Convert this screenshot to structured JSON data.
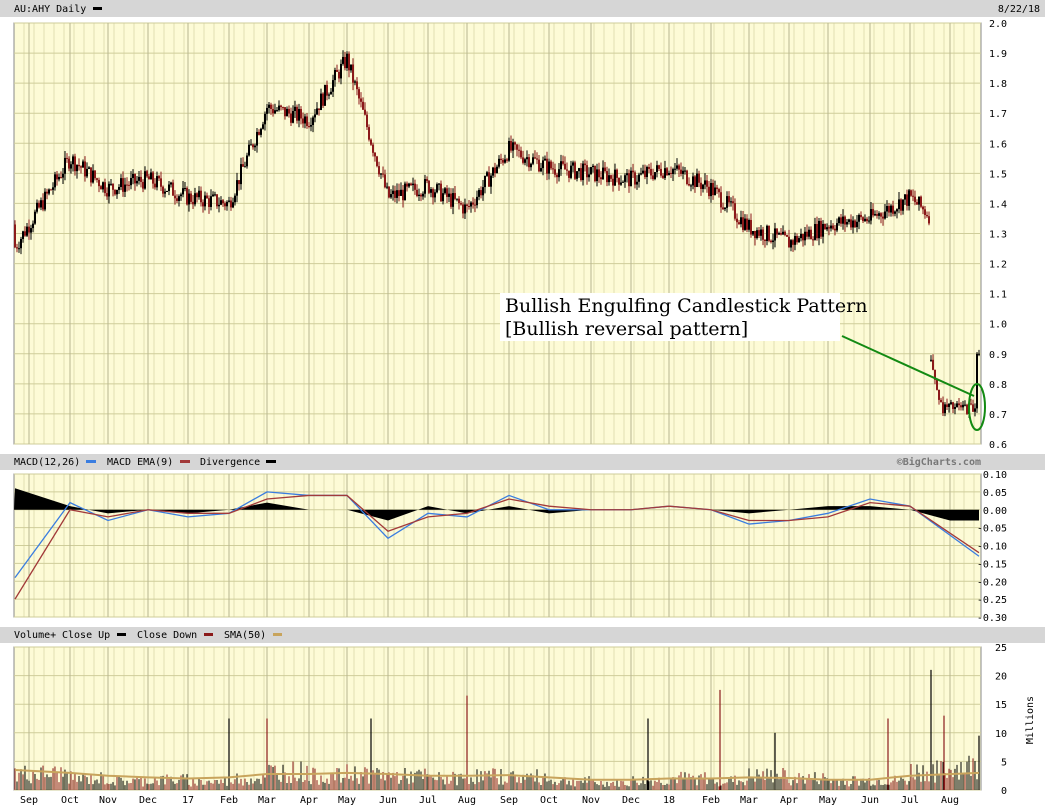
{
  "header": {
    "symbol_label": "AU:AHY Daily",
    "date": "8/22/18"
  },
  "watermark": "©BigCharts.com",
  "annotation": {
    "line1": "Bullish Engulfing Candlestick Pattern",
    "line2": "[Bullish reversal pattern]",
    "color": "#138a13"
  },
  "colors": {
    "background": "#fdfbd6",
    "grid": "#cfcd9a",
    "up": "#000000",
    "down": "#8b1a1a",
    "macd": "#3a7de0",
    "macd_ema": "#a23a3a",
    "sma": "#c8a45c"
  },
  "months": [
    "Sep",
    "Oct",
    "Nov",
    "Dec",
    "17",
    "Feb",
    "Mar",
    "Apr",
    "May",
    "Jun",
    "Jul",
    "Aug",
    "Sep",
    "Oct",
    "Nov",
    "Dec",
    "18",
    "Feb",
    "Mar",
    "Apr",
    "May",
    "Jun",
    "Jul",
    "Aug"
  ],
  "chart_data": [
    {
      "type": "line",
      "title": "AU:AHY Daily",
      "subtype": "candlestick",
      "ylim": [
        0.6,
        2.0
      ],
      "yticks": [
        "2.0",
        "1.9",
        "1.8",
        "1.7",
        "1.6",
        "1.5",
        "1.4",
        "1.3",
        "1.2",
        "1.1",
        "1.0",
        "0.9",
        "0.8",
        "0.7",
        "0.6"
      ],
      "x": [
        "Sep",
        "Oct",
        "Nov",
        "Dec",
        "17",
        "Feb",
        "Mar",
        "Apr",
        "May",
        "Jun",
        "Jul",
        "Aug",
        "Sep",
        "Oct",
        "Nov",
        "Dec",
        "18",
        "Feb",
        "Mar",
        "Apr",
        "May",
        "Jun",
        "Jul",
        "Aug"
      ],
      "series": [
        {
          "name": "Close",
          "values": [
            1.33,
            1.55,
            1.45,
            1.48,
            1.42,
            1.4,
            1.72,
            1.68,
            1.88,
            1.42,
            1.46,
            1.38,
            1.58,
            1.52,
            1.5,
            1.48,
            1.52,
            1.45,
            1.32,
            1.27,
            1.33,
            1.35,
            1.42,
            1.3
          ]
        }
      ],
      "late_values": [
        0.88,
        0.72,
        0.71,
        0.9
      ],
      "grid": true
    },
    {
      "type": "line",
      "title": "MACD(12,26)",
      "legend": [
        "MACD(12,26)",
        "MACD EMA(9)",
        "Divergence"
      ],
      "ylim": [
        -0.3,
        0.1
      ],
      "yticks": [
        "0.10",
        "0.05",
        "0.00",
        "-0.05",
        "-0.10",
        "-0.15",
        "-0.20",
        "-0.25",
        "-0.30"
      ],
      "x": [
        "Sep",
        "Oct",
        "Nov",
        "Dec",
        "17",
        "Feb",
        "Mar",
        "Apr",
        "May",
        "Jun",
        "Jul",
        "Aug",
        "Sep",
        "Oct",
        "Nov",
        "Dec",
        "18",
        "Feb",
        "Mar",
        "Apr",
        "May",
        "Jun",
        "Jul",
        "Aug"
      ],
      "series": [
        {
          "name": "MACD(12,26)",
          "values": [
            -0.19,
            0.02,
            -0.03,
            0.0,
            -0.02,
            -0.01,
            0.05,
            0.04,
            0.04,
            -0.08,
            -0.01,
            -0.02,
            0.04,
            0.0,
            0.0,
            0.0,
            0.01,
            0.0,
            -0.04,
            -0.03,
            -0.01,
            0.03,
            0.01,
            -0.13
          ]
        },
        {
          "name": "MACD EMA(9)",
          "values": [
            -0.25,
            0.0,
            -0.02,
            0.0,
            -0.01,
            -0.01,
            0.03,
            0.04,
            0.04,
            -0.06,
            -0.02,
            -0.01,
            0.03,
            0.01,
            0.0,
            0.0,
            0.01,
            0.0,
            -0.03,
            -0.03,
            -0.02,
            0.02,
            0.01,
            -0.12
          ]
        },
        {
          "name": "Divergence",
          "values": [
            0.06,
            0.01,
            -0.01,
            0.0,
            -0.01,
            0.0,
            0.02,
            0.0,
            0.0,
            -0.03,
            0.01,
            -0.01,
            0.01,
            -0.01,
            0.0,
            0.0,
            0.0,
            0.0,
            -0.01,
            0.0,
            0.01,
            0.01,
            0.0,
            -0.03
          ]
        }
      ],
      "grid": true
    },
    {
      "type": "bar",
      "title": "Volume+",
      "legend": [
        "Volume+",
        "Close Up",
        "Close Down",
        "SMA(50)"
      ],
      "ylabel": "Millions",
      "ylim": [
        0,
        25
      ],
      "yticks": [
        "25",
        "20",
        "15",
        "10",
        "5",
        "0"
      ],
      "x": [
        "Sep",
        "Oct",
        "Nov",
        "Dec",
        "17",
        "Feb",
        "Mar",
        "Apr",
        "May",
        "Jun",
        "Jul",
        "Aug",
        "Sep",
        "Oct",
        "Nov",
        "Dec",
        "18",
        "Feb",
        "Mar",
        "Apr",
        "May",
        "Jun",
        "Jul",
        "Aug"
      ],
      "series": [
        {
          "name": "Volume+",
          "values": [
            3.5,
            2.5,
            2.0,
            2.2,
            1.8,
            2.5,
            4.0,
            3.0,
            3.5,
            3.0,
            2.5,
            3.0,
            2.8,
            2.0,
            1.5,
            2.0,
            2.5,
            2.0,
            3.0,
            2.5,
            2.0,
            2.0,
            4.0,
            5.0
          ]
        },
        {
          "name": "SMA(50)",
          "values": [
            3.5,
            3.0,
            2.5,
            2.2,
            2.0,
            2.2,
            2.8,
            2.8,
            3.0,
            2.8,
            2.5,
            2.5,
            2.6,
            2.2,
            1.8,
            1.8,
            2.0,
            2.0,
            2.2,
            2.1,
            1.8,
            1.8,
            2.5,
            3.0
          ]
        }
      ],
      "spikes": [
        12.5,
        12.5,
        12.5,
        16.5,
        12.5,
        17.5,
        10.0,
        12.5,
        21.0,
        13.0,
        9.5
      ],
      "grid": true
    }
  ]
}
